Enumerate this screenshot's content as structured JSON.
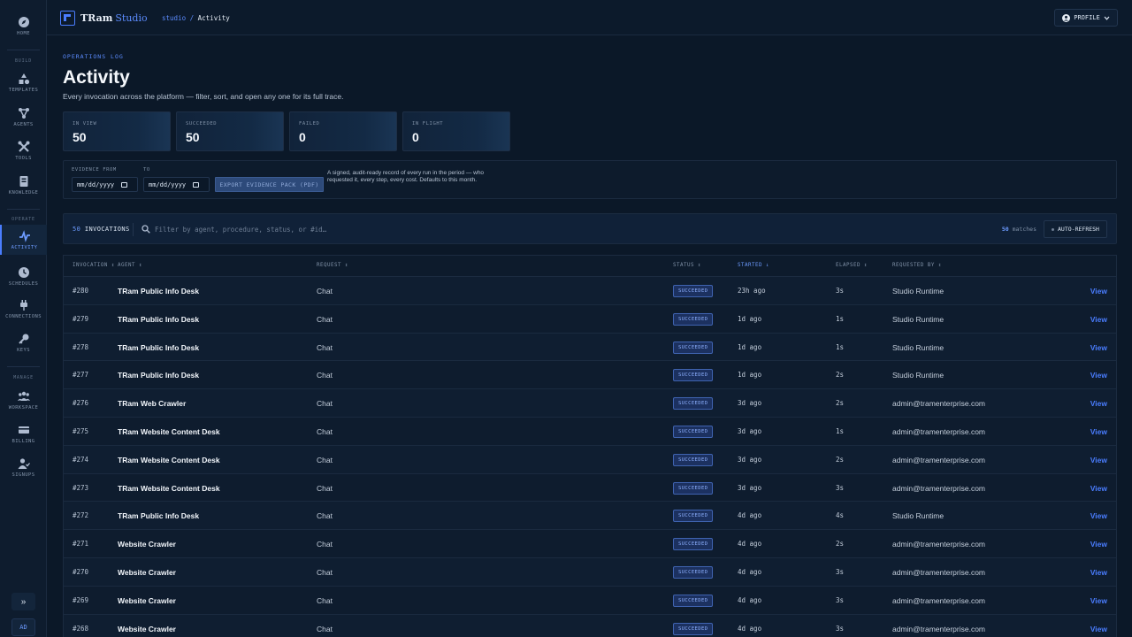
{
  "app": {
    "brand_name": "TRam",
    "brand_suffix": "Studio",
    "breadcrumb_root": "studio",
    "breadcrumb_sep": "/",
    "breadcrumb_current": "Activity",
    "profile_label": "PROFILE"
  },
  "sidebar": {
    "home": "HOME",
    "sections": {
      "build": "BUILD",
      "operate": "OPERATE",
      "manage": "MANAGE"
    },
    "items": {
      "templates": "TEMPLATES",
      "agents": "AGENTS",
      "tools": "TOOLS",
      "knowledge": "KNOWLEDGE",
      "activity": "ACTIVITY",
      "schedules": "SCHEDULES",
      "connections": "CONNECTIONS",
      "keys": "KEYS",
      "workspace": "WORKSPACE",
      "billing": "BILLING",
      "signups": "SIGNUPS"
    },
    "expand_glyph": "»",
    "avatar_initials": "AD"
  },
  "page": {
    "eyebrow": "OPERATIONS LOG",
    "title": "Activity",
    "subtitle": "Every invocation across the platform — filter, sort, and open any one for its full trace."
  },
  "stats": {
    "in_view_label": "IN VIEW",
    "in_view": "50",
    "succeeded_label": "SUCCEEDED",
    "succeeded": "50",
    "failed_label": "FAILED",
    "failed": "0",
    "in_flight_label": "IN FLIGHT",
    "in_flight": "0"
  },
  "evidence": {
    "from_label": "EVIDENCE FROM",
    "to_label": "TO",
    "from_value": "mm/dd/yyyy",
    "to_value": "mm/dd/yyyy",
    "export_label": "EXPORT EVIDENCE PACK (PDF)",
    "note": "A signed, audit-ready record of every run in the period — who requested it, every step, every cost. Defaults to this month."
  },
  "toolbar": {
    "count": "50",
    "count_label": "INVOCATIONS",
    "search_placeholder": "Filter by agent, procedure, status, or #id…",
    "matches_count": "50",
    "matches_label": "matches",
    "auto_refresh": "AUTO-REFRESH"
  },
  "table": {
    "columns": {
      "invocation": "INVOCATION ↕",
      "agent": "AGENT ↕",
      "request": "REQUEST ↕",
      "status": "STATUS ↕",
      "started": "STARTED ↓",
      "elapsed": "ELAPSED ↕",
      "requested_by": "REQUESTED BY ↕"
    },
    "view_label": "View",
    "rows": [
      {
        "id": "#280",
        "agent": "TRam Public Info Desk",
        "request": "Chat",
        "status": "SUCCEEDED",
        "started": "23h ago",
        "elapsed": "3s",
        "by": "Studio Runtime"
      },
      {
        "id": "#279",
        "agent": "TRam Public Info Desk",
        "request": "Chat",
        "status": "SUCCEEDED",
        "started": "1d ago",
        "elapsed": "1s",
        "by": "Studio Runtime"
      },
      {
        "id": "#278",
        "agent": "TRam Public Info Desk",
        "request": "Chat",
        "status": "SUCCEEDED",
        "started": "1d ago",
        "elapsed": "1s",
        "by": "Studio Runtime"
      },
      {
        "id": "#277",
        "agent": "TRam Public Info Desk",
        "request": "Chat",
        "status": "SUCCEEDED",
        "started": "1d ago",
        "elapsed": "2s",
        "by": "Studio Runtime"
      },
      {
        "id": "#276",
        "agent": "TRam Web Crawler",
        "request": "Chat",
        "status": "SUCCEEDED",
        "started": "3d ago",
        "elapsed": "2s",
        "by": "admin@tramenterprise.com"
      },
      {
        "id": "#275",
        "agent": "TRam Website Content Desk",
        "request": "Chat",
        "status": "SUCCEEDED",
        "started": "3d ago",
        "elapsed": "1s",
        "by": "admin@tramenterprise.com"
      },
      {
        "id": "#274",
        "agent": "TRam Website Content Desk",
        "request": "Chat",
        "status": "SUCCEEDED",
        "started": "3d ago",
        "elapsed": "2s",
        "by": "admin@tramenterprise.com"
      },
      {
        "id": "#273",
        "agent": "TRam Website Content Desk",
        "request": "Chat",
        "status": "SUCCEEDED",
        "started": "3d ago",
        "elapsed": "3s",
        "by": "admin@tramenterprise.com"
      },
      {
        "id": "#272",
        "agent": "TRam Public Info Desk",
        "request": "Chat",
        "status": "SUCCEEDED",
        "started": "4d ago",
        "elapsed": "4s",
        "by": "Studio Runtime"
      },
      {
        "id": "#271",
        "agent": "Website Crawler",
        "request": "Chat",
        "status": "SUCCEEDED",
        "started": "4d ago",
        "elapsed": "2s",
        "by": "admin@tramenterprise.com"
      },
      {
        "id": "#270",
        "agent": "Website Crawler",
        "request": "Chat",
        "status": "SUCCEEDED",
        "started": "4d ago",
        "elapsed": "3s",
        "by": "admin@tramenterprise.com"
      },
      {
        "id": "#269",
        "agent": "Website Crawler",
        "request": "Chat",
        "status": "SUCCEEDED",
        "started": "4d ago",
        "elapsed": "3s",
        "by": "admin@tramenterprise.com"
      },
      {
        "id": "#268",
        "agent": "Website Crawler",
        "request": "Chat",
        "status": "SUCCEEDED",
        "started": "4d ago",
        "elapsed": "3s",
        "by": "admin@tramenterprise.com"
      }
    ]
  },
  "colors": {
    "accent": "#4a7dff",
    "background": "#0b1828",
    "sidebar": "#0e1c2e",
    "status_success": "#8db0ff"
  }
}
